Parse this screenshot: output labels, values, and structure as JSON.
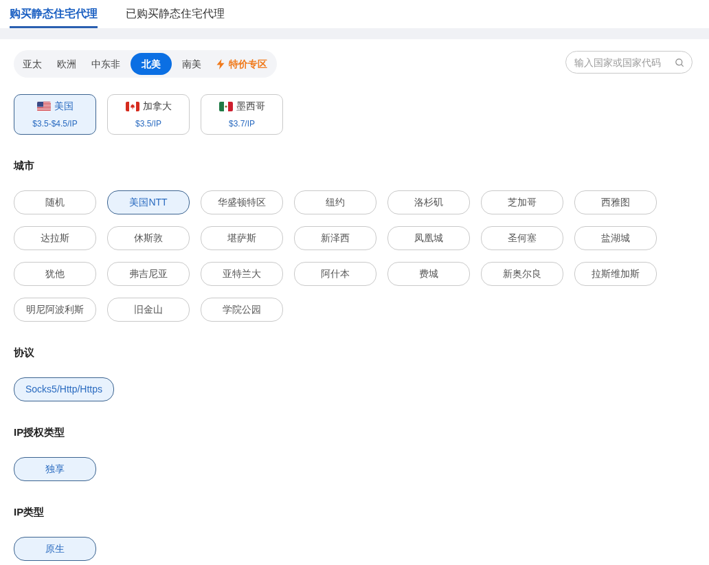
{
  "tabs": [
    {
      "label": "购买静态住宅代理",
      "selected": true
    },
    {
      "label": "已购买静态住宅代理",
      "selected": false
    }
  ],
  "region_tabs": [
    {
      "label": "亚太",
      "selected": false,
      "kind": "plain"
    },
    {
      "label": "欧洲",
      "selected": false,
      "kind": "plain"
    },
    {
      "label": "中东非",
      "selected": false,
      "kind": "plain"
    },
    {
      "label": "北美",
      "selected": true,
      "kind": "plain"
    },
    {
      "label": "南美",
      "selected": false,
      "kind": "plain"
    },
    {
      "label": "特价专区",
      "selected": false,
      "kind": "promo"
    }
  ],
  "search": {
    "placeholder": "输入国家或国家代码"
  },
  "countries": [
    {
      "kind": "us",
      "name": "美国",
      "price": "$3.5-$4.5/IP",
      "selected": true
    },
    {
      "kind": "ca",
      "name": "加拿大",
      "price": "$3.5/IP",
      "selected": false
    },
    {
      "kind": "mx",
      "name": "墨西哥",
      "price": "$3.7/IP",
      "selected": false
    }
  ],
  "sections": [
    {
      "title": "城市",
      "options": [
        {
          "label": "随机",
          "selected": false
        },
        {
          "label": "美国NTT",
          "selected": true
        },
        {
          "label": "华盛顿特区",
          "selected": false
        },
        {
          "label": "纽约",
          "selected": false
        },
        {
          "label": "洛杉矶",
          "selected": false
        },
        {
          "label": "芝加哥",
          "selected": false
        },
        {
          "label": "西雅图",
          "selected": false
        },
        {
          "label": "达拉斯",
          "selected": false
        },
        {
          "label": "休斯敦",
          "selected": false
        },
        {
          "label": "堪萨斯",
          "selected": false
        },
        {
          "label": "新泽西",
          "selected": false
        },
        {
          "label": "凤凰城",
          "selected": false
        },
        {
          "label": "圣何塞",
          "selected": false
        },
        {
          "label": "盐湖城",
          "selected": false
        },
        {
          "label": "犹他",
          "selected": false
        },
        {
          "label": "弗吉尼亚",
          "selected": false
        },
        {
          "label": "亚特兰大",
          "selected": false
        },
        {
          "label": "阿什本",
          "selected": false
        },
        {
          "label": "费城",
          "selected": false
        },
        {
          "label": "新奥尔良",
          "selected": false
        },
        {
          "label": "拉斯维加斯",
          "selected": false
        },
        {
          "label": "明尼阿波利斯",
          "selected": false
        },
        {
          "label": "旧金山",
          "selected": false
        },
        {
          "label": "学院公园",
          "selected": false
        }
      ]
    },
    {
      "title": "协议",
      "options": [
        {
          "label": "Socks5/Http/Https",
          "selected": true
        }
      ]
    },
    {
      "title": "IP授权类型",
      "options": [
        {
          "label": "独享",
          "selected": true
        }
      ]
    },
    {
      "title": "IP类型",
      "options": [
        {
          "label": "原生",
          "selected": true
        }
      ]
    }
  ]
}
